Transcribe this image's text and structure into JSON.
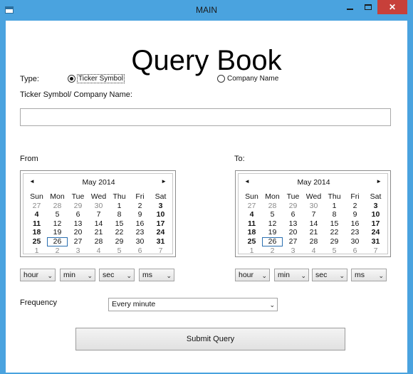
{
  "window": {
    "title": "MAIN",
    "close_glyph": "✕"
  },
  "header": {
    "title": "Query Book"
  },
  "type": {
    "label": "Type:",
    "options": [
      {
        "label": "Ticker Symbol",
        "selected": true
      },
      {
        "label": "Company Name",
        "selected": false
      }
    ]
  },
  "query": {
    "label": "Ticker Symbol/ Company Name:",
    "value": ""
  },
  "from": {
    "label": "From",
    "calendar": {
      "month": "May 2014",
      "weekdays": [
        "Sun",
        "Mon",
        "Tue",
        "Wed",
        "Thu",
        "Fri",
        "Sat"
      ],
      "weeks": [
        [
          "27",
          "28",
          "29",
          "30",
          "1",
          "2",
          "3"
        ],
        [
          "4",
          "5",
          "6",
          "7",
          "8",
          "9",
          "10"
        ],
        [
          "11",
          "12",
          "13",
          "14",
          "15",
          "16",
          "17"
        ],
        [
          "18",
          "19",
          "20",
          "21",
          "22",
          "23",
          "24"
        ],
        [
          "25",
          "26",
          "27",
          "28",
          "29",
          "30",
          "31"
        ],
        [
          "1",
          "2",
          "3",
          "4",
          "5",
          "6",
          "7"
        ]
      ],
      "today": "26"
    },
    "time": [
      "hour",
      "min",
      "sec",
      "ms"
    ]
  },
  "to": {
    "label": "To:",
    "calendar": {
      "month": "May 2014",
      "weekdays": [
        "Sun",
        "Mon",
        "Tue",
        "Wed",
        "Thu",
        "Fri",
        "Sat"
      ],
      "weeks": [
        [
          "27",
          "28",
          "29",
          "30",
          "1",
          "2",
          "3"
        ],
        [
          "4",
          "5",
          "6",
          "7",
          "8",
          "9",
          "10"
        ],
        [
          "11",
          "12",
          "13",
          "14",
          "15",
          "16",
          "17"
        ],
        [
          "18",
          "19",
          "20",
          "21",
          "22",
          "23",
          "24"
        ],
        [
          "25",
          "26",
          "27",
          "28",
          "29",
          "30",
          "31"
        ],
        [
          "1",
          "2",
          "3",
          "4",
          "5",
          "6",
          "7"
        ]
      ],
      "today": "26"
    },
    "time": [
      "hour",
      "min",
      "sec",
      "ms"
    ]
  },
  "frequency": {
    "label": "Frequency",
    "value": "Every minute"
  },
  "submit": {
    "label": "Submit Query"
  }
}
